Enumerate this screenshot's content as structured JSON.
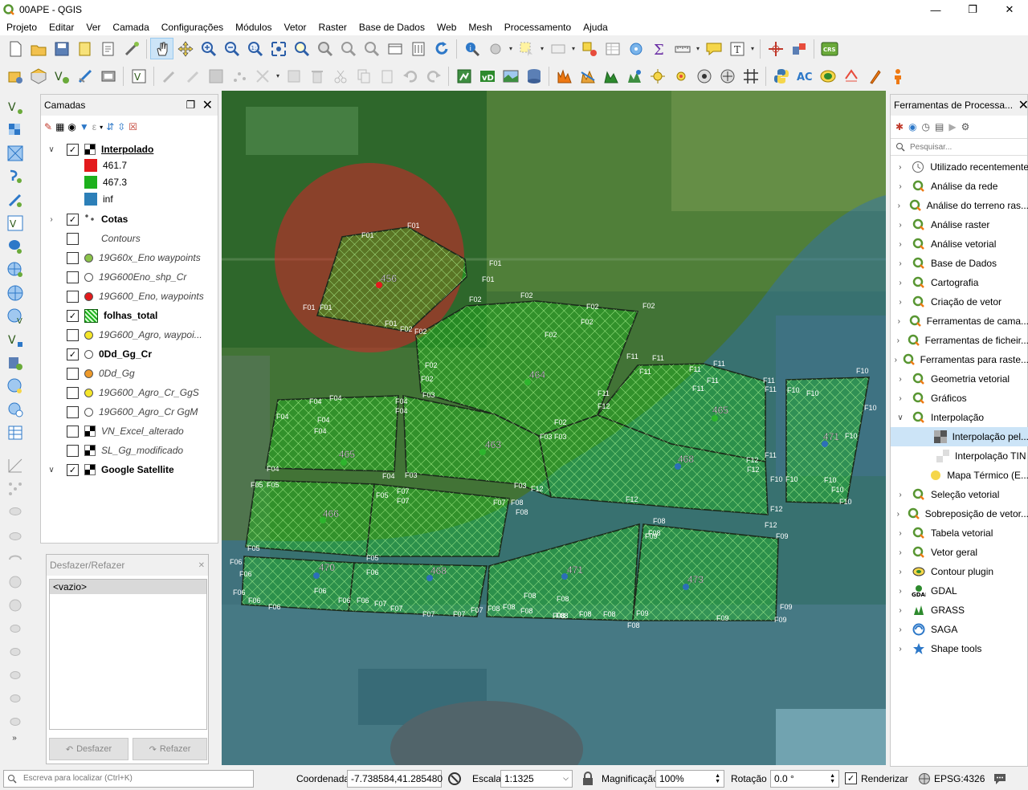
{
  "window": {
    "title": "00APE - QGIS"
  },
  "menu": [
    "Projeto",
    "Editar",
    "Ver",
    "Camada",
    "Configurações",
    "Módulos",
    "Vetor",
    "Raster",
    "Base de Dados",
    "Web",
    "Mesh",
    "Processamento",
    "Ajuda"
  ],
  "layers_panel": {
    "title": "Camadas",
    "layers": [
      {
        "name": "Interpolado",
        "checked": true,
        "expanded": true,
        "style": "bold-underline"
      },
      {
        "name": "Cotas",
        "checked": true,
        "expanded": false,
        "style": "bold"
      },
      {
        "name": "Contours",
        "checked": false,
        "style": "italic"
      },
      {
        "name": "19G60x_Eno waypoints",
        "checked": false,
        "style": "italic"
      },
      {
        "name": "19G600Eno_shp_Cr",
        "checked": false,
        "style": "italic"
      },
      {
        "name": "19G600_Eno, waypoints",
        "checked": false,
        "style": "italic"
      },
      {
        "name": "folhas_total",
        "checked": true,
        "style": "bold"
      },
      {
        "name": "19G600_Agro, waypoi...",
        "checked": false,
        "style": "italic"
      },
      {
        "name": "0Dd_Gg_Cr",
        "checked": true,
        "style": "bold"
      },
      {
        "name": "0Dd_Gg",
        "checked": false,
        "style": "italic"
      },
      {
        "name": "19G600_Agro_Cr_GgS",
        "checked": false,
        "style": "italic"
      },
      {
        "name": "19G600_Agro_Cr GgM",
        "checked": false,
        "style": "italic"
      },
      {
        "name": "VN_Excel_alterado",
        "checked": false,
        "style": "italic"
      },
      {
        "name": "SL_Gg_modificado",
        "checked": false,
        "style": "italic"
      },
      {
        "name": "Google Satellite",
        "checked": true,
        "expanded": true,
        "style": "bold"
      }
    ],
    "legend": [
      {
        "label": "461.7",
        "color": "#e31a1c"
      },
      {
        "label": "467.3",
        "color": "#1db01d"
      },
      {
        "label": "inf",
        "color": "#2c7fb8"
      }
    ]
  },
  "undo_panel": {
    "title": "Desfazer/Refazer",
    "item": "<vazio>",
    "undo": "Desfazer",
    "redo": "Refazer"
  },
  "processing_panel": {
    "title": "Ferramentas de Processa...",
    "search_placeholder": "Pesquisar...",
    "items": [
      {
        "label": "Utilizado recentemente",
        "kind": "recent"
      },
      {
        "label": "Análise da rede",
        "kind": "q"
      },
      {
        "label": "Análise do terreno ras...",
        "kind": "q"
      },
      {
        "label": "Análise raster",
        "kind": "q"
      },
      {
        "label": "Análise vetorial",
        "kind": "q"
      },
      {
        "label": "Base de Dados",
        "kind": "q"
      },
      {
        "label": "Cartografia",
        "kind": "q"
      },
      {
        "label": "Criação de vetor",
        "kind": "q"
      },
      {
        "label": "Ferramentas de cama...",
        "kind": "q"
      },
      {
        "label": "Ferramentas de ficheir...",
        "kind": "q"
      },
      {
        "label": "Ferramentas para raste...",
        "kind": "q"
      },
      {
        "label": "Geometria vetorial",
        "kind": "q"
      },
      {
        "label": "Gráficos",
        "kind": "q"
      },
      {
        "label": "Interpolação",
        "kind": "q",
        "expanded": true
      },
      {
        "label": "Interpolação pel...",
        "kind": "child",
        "selected": true
      },
      {
        "label": "Interpolação TIN",
        "kind": "child"
      },
      {
        "label": "Mapa Térmico (E...",
        "kind": "child"
      },
      {
        "label": "Seleção vetorial",
        "kind": "q"
      },
      {
        "label": "Sobreposição de vetor...",
        "kind": "q"
      },
      {
        "label": "Tabela vetorial",
        "kind": "q"
      },
      {
        "label": "Vetor geral",
        "kind": "q"
      },
      {
        "label": "Contour plugin",
        "kind": "plugin"
      },
      {
        "label": "GDAL",
        "kind": "gdal"
      },
      {
        "label": "GRASS",
        "kind": "grass"
      },
      {
        "label": "SAGA",
        "kind": "saga"
      },
      {
        "label": "Shape tools",
        "kind": "star"
      }
    ]
  },
  "map": {
    "parcel_values": [
      "456",
      "464",
      "465",
      "463",
      "468",
      "471",
      "465",
      "466",
      "470",
      "468",
      "471",
      "473"
    ],
    "point_labels": [
      "F01",
      "F02",
      "F03",
      "F04",
      "F05",
      "F06",
      "F07",
      "F08",
      "F09",
      "F10",
      "F11",
      "F12"
    ]
  },
  "statusbar": {
    "locate_placeholder": "Escreva para localizar (Ctrl+K)",
    "coord_label": "Coordenada",
    "coord_value": "-7.738584,41.285480",
    "scale_label": "Escala",
    "scale_value": "1:1325",
    "magnification_label": "Magnificação",
    "magnification_value": "100%",
    "rotation_label": "Rotação",
    "rotation_value": "0.0 °",
    "render_label": "Renderizar",
    "crs": "EPSG:4326"
  }
}
